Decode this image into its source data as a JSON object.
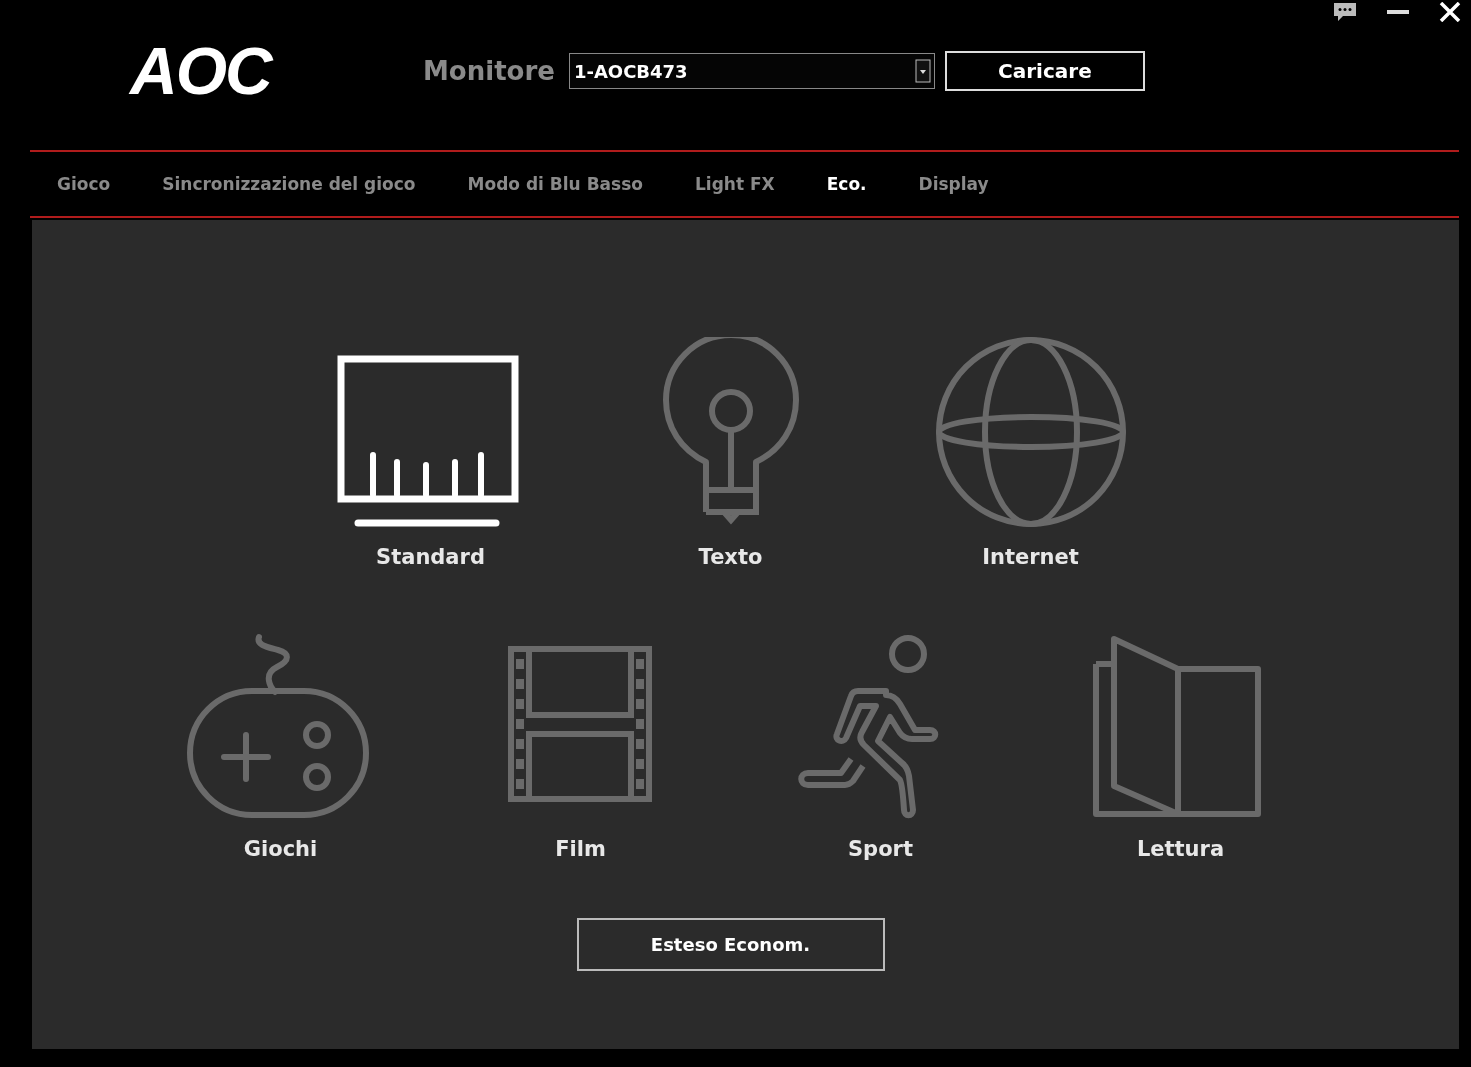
{
  "header": {
    "logo": "AOC",
    "monitor_label": "Monitore",
    "monitor_select": {
      "value": "1-AOCB473"
    },
    "load_button": "Caricare"
  },
  "tabs": [
    {
      "label": "Gioco",
      "selected": false
    },
    {
      "label": "Sincronizzazione del gioco",
      "selected": false
    },
    {
      "label": "Modo di Blu Basso",
      "selected": false
    },
    {
      "label": "Light FX",
      "selected": false
    },
    {
      "label": "Eco.",
      "selected": true
    },
    {
      "label": "Display",
      "selected": false
    }
  ],
  "mode_rows": [
    [
      {
        "kind": "monitor",
        "label": "Standard",
        "selected": true
      },
      {
        "kind": "bulb",
        "label": "Texto",
        "selected": false
      },
      {
        "kind": "globe",
        "label": "Internet",
        "selected": false
      }
    ],
    [
      {
        "kind": "gamepad",
        "label": "Giochi",
        "selected": false
      },
      {
        "kind": "film",
        "label": "Film",
        "selected": false
      },
      {
        "kind": "runner",
        "label": "Sport",
        "selected": false
      },
      {
        "kind": "book",
        "label": "Lettura",
        "selected": false
      }
    ]
  ],
  "extended_button": "Esteso Econom."
}
